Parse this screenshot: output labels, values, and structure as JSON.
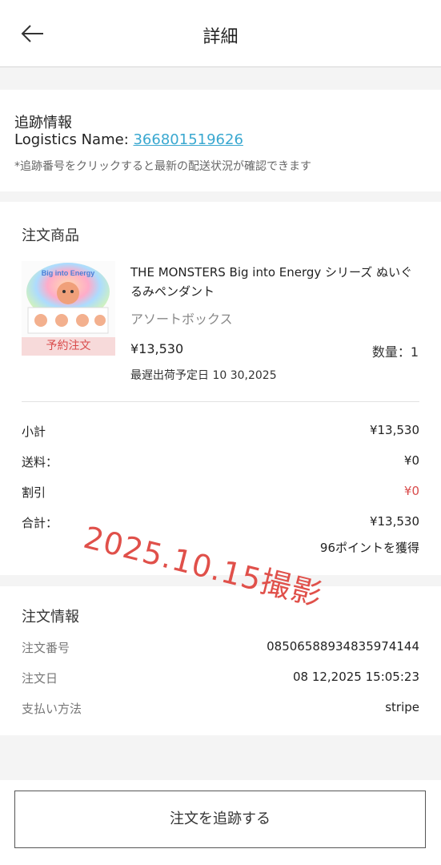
{
  "header": {
    "title": "詳細"
  },
  "tracking": {
    "title": "追跡情報",
    "logistics_label": "Logistics Name: ",
    "tracking_number": "366801519626",
    "note": "*追跡番号をクリックすると最新の配送状況が確認できます"
  },
  "items": {
    "title": "注文商品",
    "product": {
      "name": "THE MONSTERS Big into Energy シリーズ ぬいぐるみペンダント",
      "variant": "アソートボックス",
      "badge": "予約注文",
      "price": "¥13,530",
      "qty": "数量：1",
      "ship_date": "最遅出荷予定日 10 30,2025"
    },
    "summary": {
      "subtotal_label": "小計",
      "subtotal_value": "¥13,530",
      "shipping_label": "送料：",
      "shipping_value": "¥0",
      "discount_label": "割引",
      "discount_value": "¥0",
      "total_label": "合計：",
      "total_value": "¥13,530",
      "points": "96ポイントを獲得"
    }
  },
  "info": {
    "title": "注文情報",
    "order_no_label": "注文番号",
    "order_no_value": "08506588934835974144",
    "order_date_label": "注文日",
    "order_date_value": "08 12,2025 15:05:23",
    "payment_label": "支払い方法",
    "payment_value": "stripe"
  },
  "bottom": {
    "track_button": "注文を追跡する"
  },
  "watermark": "2025.10.15撮影",
  "colors": {
    "link": "#3aa8d0",
    "accent_red": "#d94b4b",
    "watermark": "#e0504a"
  }
}
